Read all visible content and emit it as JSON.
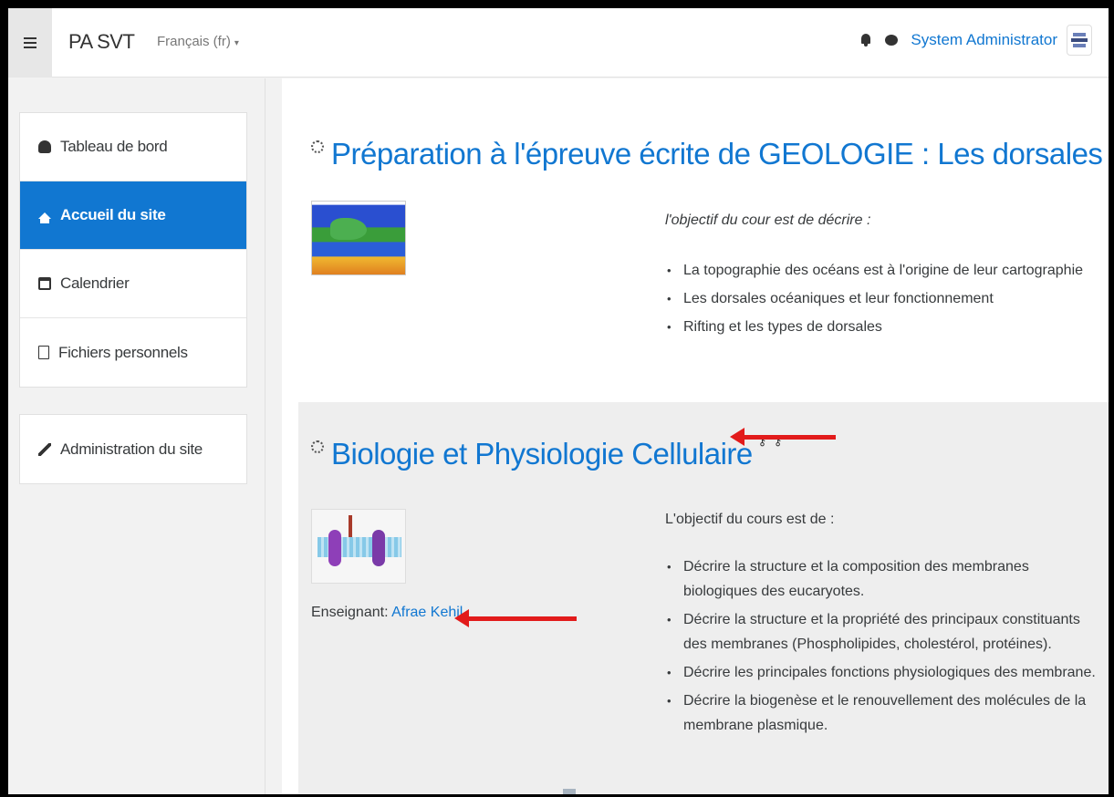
{
  "navbar": {
    "brand": "PA SVT",
    "language": "Français (fr)",
    "caret": "▾",
    "user_name": "System Administrator"
  },
  "sidebar": {
    "items": [
      {
        "label": "Tableau de bord",
        "icon": "dashboard-icon"
      },
      {
        "label": "Accueil du site",
        "icon": "home-icon",
        "active": true
      },
      {
        "label": "Calendrier",
        "icon": "calendar-icon"
      },
      {
        "label": "Fichiers personnels",
        "icon": "file-icon"
      }
    ],
    "admin": {
      "label": "Administration du site",
      "icon": "wrench-icon"
    }
  },
  "courses": [
    {
      "title": "Préparation à l'épreuve écrite de GEOLOGIE : Les dorsales océaniques",
      "intro": "l'objectif du cour est de décrire :",
      "points": [
        "La topographie des océans est à l'origine de leur cartographie",
        "Les dorsales océaniques et leur fonctionnement",
        "Rifting et les types de dorsales"
      ]
    },
    {
      "title": "Biologie et Physiologie Cellulaire",
      "keys": "⚷ ⚷",
      "intro": "L'objectif du cours est de :",
      "points": [
        "Décrire la structure et la composition des membranes biologiques des eucaryotes.",
        "Décrire la structure et la propriété des principaux constituants des membranes (Phospholipides, cholestérol, protéines).",
        "Décrire les principales fonctions physiologiques des membrane.",
        "Décrire la biogenèse et le renouvellement des molécules de la membrane plasmique."
      ],
      "teacher_label": "Enseignant: ",
      "teacher_name": "Afrae Kehil"
    }
  ],
  "colors": {
    "accent": "#1177d1",
    "arrow": "#e21b1b"
  }
}
